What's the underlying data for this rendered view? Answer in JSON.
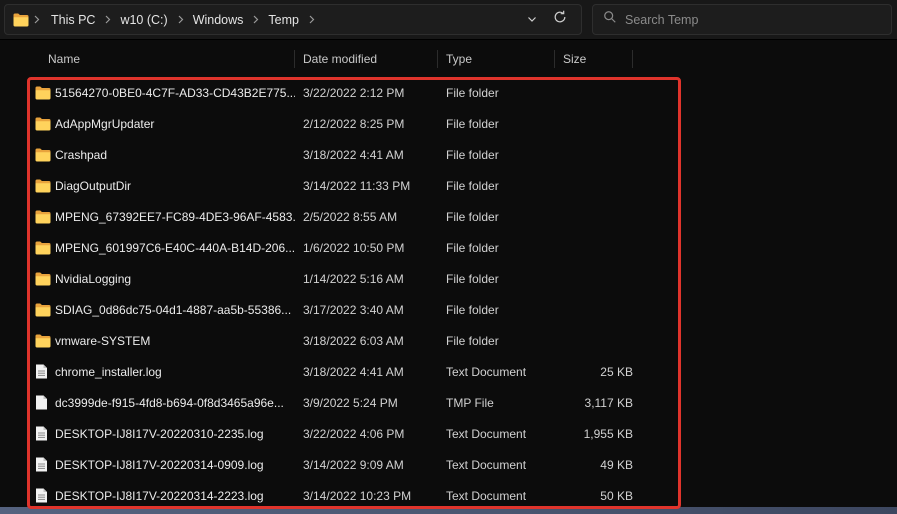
{
  "address_bar": {
    "breadcrumbs": [
      "This PC",
      "w10 (C:)",
      "Windows",
      "Temp"
    ],
    "search_placeholder": "Search Temp"
  },
  "columns": [
    "Name",
    "Date modified",
    "Type",
    "Size"
  ],
  "files": [
    {
      "icon": "folder",
      "name": "51564270-0BE0-4C7F-AD33-CD43B2E775...",
      "date": "3/22/2022 2:12 PM",
      "type": "File folder",
      "size": ""
    },
    {
      "icon": "folder",
      "name": "AdAppMgrUpdater",
      "date": "2/12/2022 8:25 PM",
      "type": "File folder",
      "size": ""
    },
    {
      "icon": "folder",
      "name": "Crashpad",
      "date": "3/18/2022 4:41 AM",
      "type": "File folder",
      "size": ""
    },
    {
      "icon": "folder",
      "name": "DiagOutputDir",
      "date": "3/14/2022 11:33 PM",
      "type": "File folder",
      "size": ""
    },
    {
      "icon": "folder",
      "name": "MPENG_67392EE7-FC89-4DE3-96AF-4583...",
      "date": "2/5/2022 8:55 AM",
      "type": "File folder",
      "size": ""
    },
    {
      "icon": "folder",
      "name": "MPENG_601997C6-E40C-440A-B14D-206...",
      "date": "1/6/2022 10:50 PM",
      "type": "File folder",
      "size": ""
    },
    {
      "icon": "folder",
      "name": "NvidiaLogging",
      "date": "1/14/2022 5:16 AM",
      "type": "File folder",
      "size": ""
    },
    {
      "icon": "folder",
      "name": "SDIAG_0d86dc75-04d1-4887-aa5b-55386...",
      "date": "3/17/2022 3:40 AM",
      "type": "File folder",
      "size": ""
    },
    {
      "icon": "folder",
      "name": "vmware-SYSTEM",
      "date": "3/18/2022 6:03 AM",
      "type": "File folder",
      "size": ""
    },
    {
      "icon": "text-document",
      "name": "chrome_installer.log",
      "date": "3/18/2022 4:41 AM",
      "type": "Text Document",
      "size": "25 KB"
    },
    {
      "icon": "file",
      "name": "dc3999de-f915-4fd8-b694-0f8d3465a96e...",
      "date": "3/9/2022 5:24 PM",
      "type": "TMP File",
      "size": "3,117 KB"
    },
    {
      "icon": "text-document",
      "name": "DESKTOP-IJ8I17V-20220310-2235.log",
      "date": "3/22/2022 4:06 PM",
      "type": "Text Document",
      "size": "1,955 KB"
    },
    {
      "icon": "text-document",
      "name": "DESKTOP-IJ8I17V-20220314-0909.log",
      "date": "3/14/2022 9:09 AM",
      "type": "Text Document",
      "size": "49 KB"
    },
    {
      "icon": "text-document",
      "name": "DESKTOP-IJ8I17V-20220314-2223.log",
      "date": "3/14/2022 10:23 PM",
      "type": "Text Document",
      "size": "50 KB"
    }
  ],
  "colors": {
    "highlight_red": "#e0342c",
    "folder_front": "#ffd35c",
    "folder_back": "#e8a33d",
    "background": "#0c0c0c",
    "bottom_strip": "#4a5671"
  }
}
